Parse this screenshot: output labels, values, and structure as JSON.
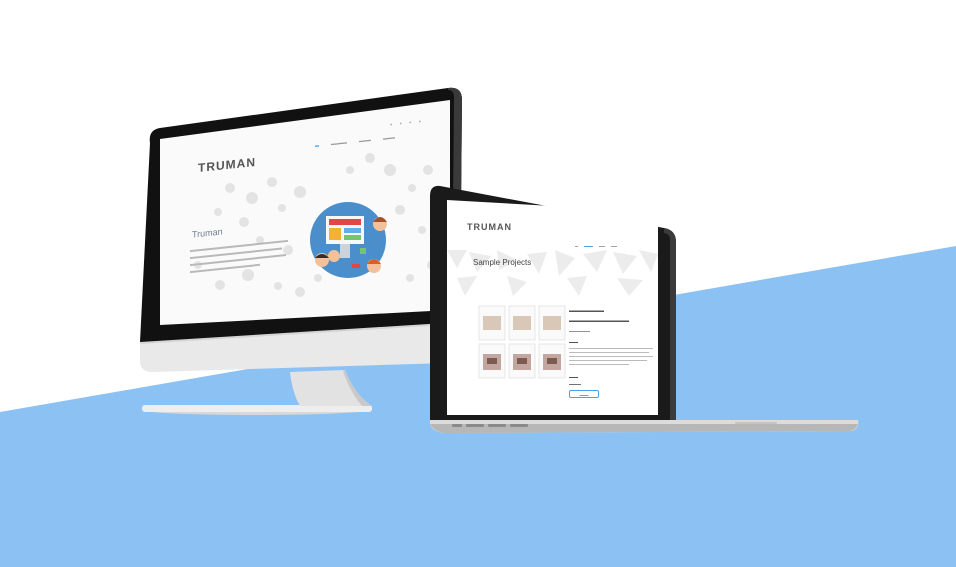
{
  "desktop_site": {
    "logo": "TRUMAN",
    "title": "Truman"
  },
  "laptop_site": {
    "logo": "TRUMAN",
    "title": "Sample Projects"
  },
  "colors": {
    "background_band": "#8bc2f3",
    "accent": "#3d9be9",
    "illustration_circle": "#4a8fcc"
  }
}
